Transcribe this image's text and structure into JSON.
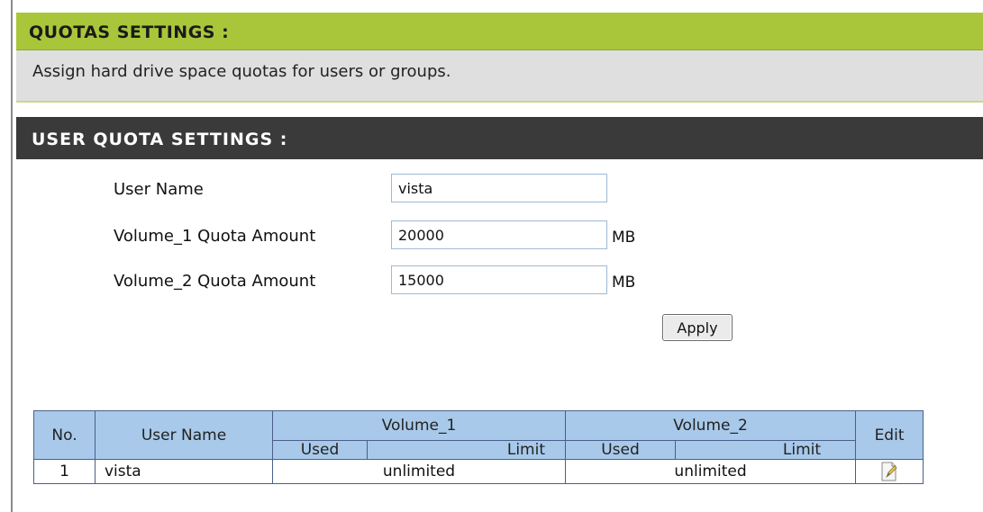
{
  "quotas_section": {
    "title": "QUOTAS SETTINGS :",
    "description": "Assign hard drive space quotas for users or groups."
  },
  "user_quota_section": {
    "title": "USER QUOTA SETTINGS :",
    "user_name_label": "User Name",
    "user_name_value": "vista",
    "volume1_label": "Volume_1 Quota Amount",
    "volume1_value": "20000",
    "volume1_unit": "MB",
    "volume2_label": "Volume_2 Quota Amount",
    "volume2_value": "15000",
    "volume2_unit": "MB",
    "apply_label": "Apply"
  },
  "quota_table": {
    "headers": {
      "no": "No.",
      "user_name": "User Name",
      "volume1": "Volume_1",
      "volume2": "Volume_2",
      "used": "Used",
      "limit": "Limit",
      "edit": "Edit"
    },
    "rows": [
      {
        "no": "1",
        "user_name": "vista",
        "volume1": "unlimited",
        "volume2": "unlimited",
        "edit_icon": "edit-icon"
      }
    ]
  },
  "colors": {
    "green_header": "#a9c63b",
    "dark_header": "#3a3a3a",
    "table_header": "#a8c9ea"
  }
}
